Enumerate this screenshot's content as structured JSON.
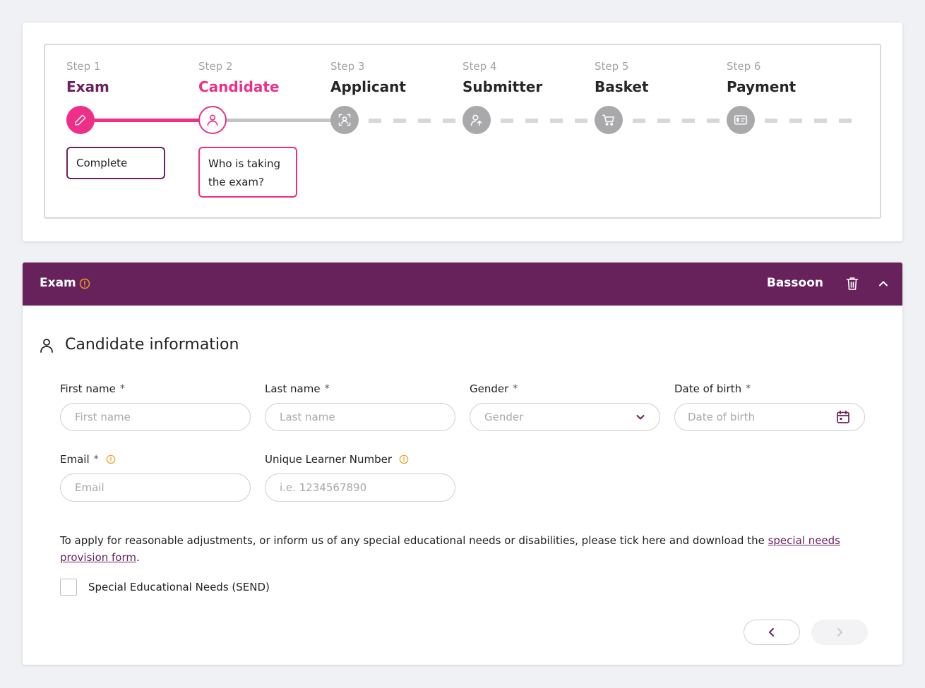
{
  "stepper": {
    "steps": [
      {
        "num": "Step 1",
        "name": "Exam",
        "status": "Complete",
        "icon": "pencil-icon"
      },
      {
        "num": "Step 2",
        "name": "Candidate",
        "status": "Who is taking the exam?",
        "icon": "user-icon"
      },
      {
        "num": "Step 3",
        "name": "Applicant",
        "icon": "user-focus-icon"
      },
      {
        "num": "Step 4",
        "name": "Submitter",
        "icon": "user-upload-icon"
      },
      {
        "num": "Step 5",
        "name": "Basket",
        "icon": "cart-icon"
      },
      {
        "num": "Step 6",
        "name": "Payment",
        "icon": "payment-card-icon"
      }
    ]
  },
  "exam_panel": {
    "title": "Exam",
    "instrument": "Bassoon",
    "section_title": "Candidate information",
    "fields": {
      "first_name": {
        "label": "First name",
        "required": "*",
        "placeholder": "First name"
      },
      "last_name": {
        "label": "Last name",
        "required": "*",
        "placeholder": "Last name"
      },
      "gender": {
        "label": "Gender",
        "required": "*",
        "placeholder": "Gender"
      },
      "dob": {
        "label": "Date of birth",
        "required": "*",
        "placeholder": "Date of birth"
      },
      "email": {
        "label": "Email",
        "required": "*",
        "placeholder": "Email"
      },
      "uln": {
        "label": "Unique Learner Number",
        "placeholder": "i.e. 1234567890"
      }
    },
    "send": {
      "text": "To apply for reasonable adjustments, or inform us of any special educational needs or disabilities, please tick here and download the ",
      "link": "special needs provision form",
      "text_end": ".",
      "checkbox_label": "Special Educational Needs (SEND)"
    }
  },
  "colors": {
    "brand_purple": "#68225b",
    "accent_pink": "#ee2f87",
    "warning_orange": "#f0a01e"
  }
}
